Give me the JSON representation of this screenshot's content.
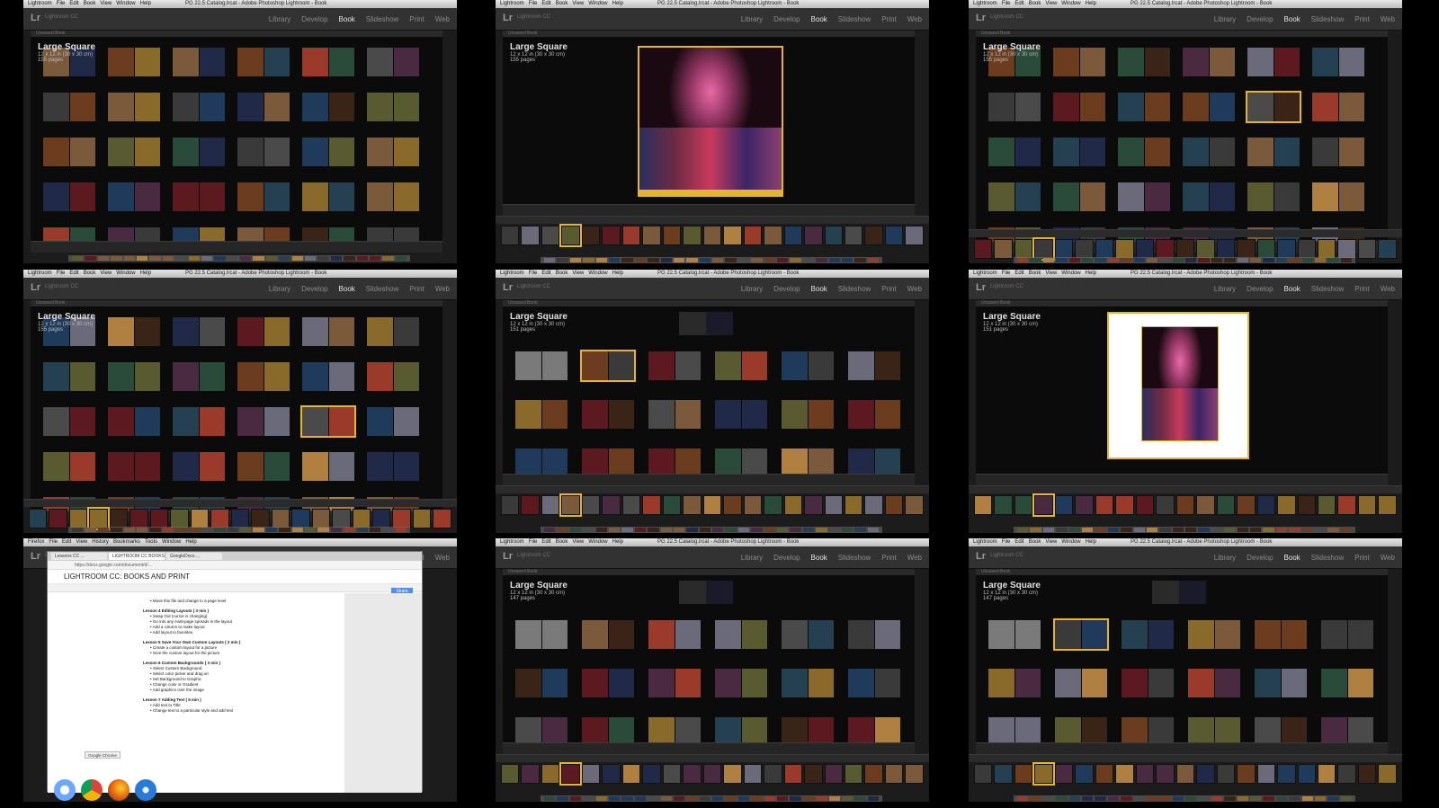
{
  "os_menu": [
    "Lightroom",
    "File",
    "Edit",
    "Book",
    "View",
    "Window",
    "Help"
  ],
  "chrome_menu": [
    "Firefox",
    "File",
    "Edit",
    "View",
    "History",
    "Bookmarks",
    "Tools",
    "Window",
    "Help"
  ],
  "window_title": "PG 22.5 Catalog.lrcat - Adobe Photoshop Lightroom - Book",
  "app": {
    "logo": "Lr",
    "name": "Lightroom CC"
  },
  "modules": [
    "Library",
    "Develop",
    "Book",
    "Slideshow",
    "Print",
    "Web"
  ],
  "active_module": "Book",
  "subbar": "Unsaved Book",
  "book": {
    "title": "Large Square",
    "size": "12 x 12 in (30 x 30 cm)"
  },
  "tiles": [
    {
      "id": "t1",
      "view": "grid",
      "pages": "155 pages"
    },
    {
      "id": "t2",
      "view": "single",
      "pages": "155 pages"
    },
    {
      "id": "t3",
      "view": "grid",
      "pages": "155 pages"
    },
    {
      "id": "t4",
      "view": "grid",
      "pages": "155 pages"
    },
    {
      "id": "t5",
      "view": "spreads",
      "pages": "151 pages"
    },
    {
      "id": "t6",
      "view": "page",
      "pages": "151 pages"
    },
    {
      "id": "t7",
      "view": "docs"
    },
    {
      "id": "t8",
      "view": "spreads",
      "pages": "147 pages"
    },
    {
      "id": "t9",
      "view": "spreads",
      "pages": "147 pages"
    }
  ],
  "docs": {
    "tabs": [
      "Lessons CC ...",
      "LIGHTROOM CC BOOKS ...",
      "GoogleDocs ..."
    ],
    "url": "https://docs.google.com/document/d/...",
    "title": "LIGHTROOM CC: BOOKS AND PRINT",
    "share": "Share",
    "google_chrome_label": "Google Chrome",
    "sections": [
      {
        "heading": "",
        "items": [
          "Move this file and change to a page level"
        ]
      },
      {
        "heading": "Lesson 4 Editing Layouts ( 3 min )",
        "items": [
          "Swap Out (cursor is changing)",
          "Go into any multi-page spreads in the layout",
          "Add a column to make layout",
          "Add layout to favorites"
        ]
      },
      {
        "heading": "Lesson 5 Save Your Own Custom Layouts ( 2 min )",
        "items": [
          "Create a custom layout for a picture",
          "Give the custom layout for the picture"
        ]
      },
      {
        "heading": "Lesson 6 Custom Backgrounds ( 3 min )",
        "items": [
          "Select Custom Background",
          "Select color picker and drag on",
          "Set Background to Graphic",
          "Change color or Gradient",
          "Add graphics over the image"
        ]
      },
      {
        "heading": "Lesson 7 Adding Text ( 5 min )",
        "items": [
          "Add text to Title",
          "Change text to a particular style and add text"
        ]
      }
    ]
  },
  "colors": {
    "accent_selected": "#e3b62c",
    "panel": "#323232",
    "workspace": "#0b0b0b"
  }
}
